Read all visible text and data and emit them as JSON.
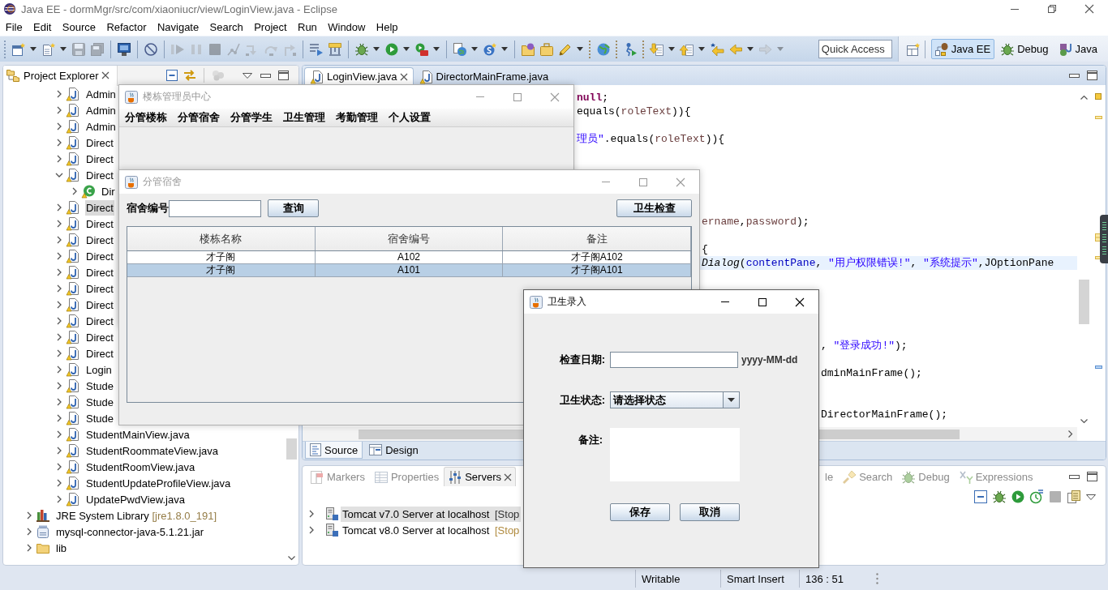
{
  "window": {
    "title": "Java EE - dormMgr/src/com/xiaoniucr/view/LoginView.java - Eclipse"
  },
  "menu": [
    "File",
    "Edit",
    "Source",
    "Refactor",
    "Navigate",
    "Search",
    "Project",
    "Run",
    "Window",
    "Help"
  ],
  "toolbar": [
    {
      "disabled": false
    },
    {
      "disabled": false
    },
    {
      "disabled": true
    },
    {
      "disabled": true
    },
    {
      "disabled": false
    },
    {
      "disabled": false
    },
    {
      "disabled": true
    },
    {
      "disabled": true
    },
    {
      "disabled": true
    },
    {
      "disabled": true
    },
    {
      "disabled": true
    },
    {
      "disabled": true
    },
    {
      "disabled": true
    },
    {
      "disabled": false
    },
    {
      "disabled": false
    },
    {
      "disabled": false
    },
    {
      "disabled": false
    },
    {
      "disabled": false
    },
    {
      "disabled": false
    },
    {
      "disabled": false
    },
    {
      "disabled": false
    },
    {
      "disabled": false
    },
    {
      "disabled": false
    },
    {
      "disabled": false
    },
    {
      "disabled": false
    },
    {
      "disabled": false
    },
    {
      "disabled": false
    },
    {
      "disabled": false
    },
    {
      "disabled": false
    },
    {
      "disabled": true
    }
  ],
  "quick_access": {
    "placeholder": "Quick Access"
  },
  "perspectives": [
    {
      "label": "Java EE",
      "selected": true
    },
    {
      "label": "Debug",
      "selected": false
    },
    {
      "label": "Java",
      "selected": false
    }
  ],
  "project_explorer": {
    "title": "Project Explorer",
    "package_files": [
      {
        "label": "Admin",
        "kind": "java_file",
        "expanded": false,
        "selected": false
      },
      {
        "label": "Admin",
        "kind": "java_file",
        "expanded": false,
        "selected": false
      },
      {
        "label": "Admin",
        "kind": "java_file",
        "expanded": false,
        "selected": false
      },
      {
        "label": "Direct",
        "kind": "java_file",
        "expanded": false,
        "selected": false
      },
      {
        "label": "Direct",
        "kind": "java_file",
        "expanded": false,
        "selected": false
      },
      {
        "label": "Direct",
        "kind": "java_file",
        "expanded": true,
        "selected": false,
        "children": [
          {
            "label": "Dir",
            "kind": "class",
            "expanded": false,
            "selected": false
          }
        ]
      },
      {
        "label": "Direct",
        "kind": "java_file",
        "expanded": false,
        "selected": true
      },
      {
        "label": "Direct",
        "kind": "java_file",
        "expanded": false,
        "selected": false
      },
      {
        "label": "Direct",
        "kind": "java_file",
        "expanded": false,
        "selected": false
      },
      {
        "label": "Direct",
        "kind": "java_file",
        "expanded": false,
        "selected": false
      },
      {
        "label": "Direct",
        "kind": "java_file",
        "expanded": false,
        "selected": false
      },
      {
        "label": "Direct",
        "kind": "java_file",
        "expanded": false,
        "selected": false
      },
      {
        "label": "Direct",
        "kind": "java_file",
        "expanded": false,
        "selected": false
      },
      {
        "label": "Direct",
        "kind": "java_file",
        "expanded": false,
        "selected": false
      },
      {
        "label": "Direct",
        "kind": "java_file",
        "expanded": false,
        "selected": false
      },
      {
        "label": "Direct",
        "kind": "java_file",
        "expanded": false,
        "selected": false
      },
      {
        "label": "Login",
        "kind": "java_file",
        "expanded": false,
        "selected": false
      },
      {
        "label": "Stude",
        "kind": "java_file",
        "expanded": false,
        "selected": false
      },
      {
        "label": "Stude",
        "kind": "java_file",
        "expanded": false,
        "selected": false
      },
      {
        "label": "Stude",
        "kind": "java_file",
        "expanded": false,
        "selected": false
      },
      {
        "label": "StudentMainView.java",
        "kind": "java_file",
        "expanded": false,
        "selected": false
      },
      {
        "label": "StudentRoommateView.java",
        "kind": "java_file",
        "expanded": false,
        "selected": false
      },
      {
        "label": "StudentRoomView.java",
        "kind": "java_file",
        "expanded": false,
        "selected": false
      },
      {
        "label": "StudentUpdateProfileView.java",
        "kind": "java_file",
        "expanded": false,
        "selected": false
      },
      {
        "label": "UpdatePwdView.java",
        "kind": "java_file",
        "expanded": false,
        "selected": false
      }
    ],
    "project_items": [
      {
        "label": "JRE System Library",
        "decoration": "[jre1.8.0_191]",
        "kind": "library",
        "expanded": false,
        "selected": false
      },
      {
        "label": "mysql-connector-java-5.1.21.jar",
        "kind": "jar",
        "expanded": false,
        "selected": false
      },
      {
        "label": "lib",
        "kind": "folder",
        "expanded": false,
        "selected": false
      }
    ]
  },
  "editor": {
    "tabs": [
      {
        "label": "LoginView.java",
        "selected": true
      },
      {
        "label": "DirectorMainFrame.java",
        "selected": false
      }
    ],
    "lines": [
      {
        "current": false,
        "tokens": [
          {
            "kind": "keyword",
            "text": "null"
          },
          {
            "kind": "plain",
            "text": ";"
          }
        ]
      },
      {
        "current": false,
        "tokens": [
          {
            "kind": "plain",
            "text": "equals("
          },
          {
            "kind": "local",
            "text": "roleText"
          },
          {
            "kind": "plain",
            "text": ")){"
          }
        ]
      },
      {
        "current": false,
        "tokens": [
          {
            "kind": "string",
            "text": "理员\""
          },
          {
            "kind": "plain",
            "text": ".equals("
          },
          {
            "kind": "local",
            "text": "roleText"
          },
          {
            "kind": "plain",
            "text": ")){"
          }
        ]
      },
      {
        "current": false,
        "tokens": [
          {
            "kind": "local",
            "text": "ername"
          },
          {
            "kind": "plain",
            "text": ","
          },
          {
            "kind": "local",
            "text": "password"
          },
          {
            "kind": "plain",
            "text": ");"
          }
        ]
      },
      {
        "current": false,
        "tokens": [
          {
            "kind": "plain",
            "text": "{"
          }
        ]
      },
      {
        "current": true,
        "tokens": [
          {
            "kind": "static",
            "text": "Dialog"
          },
          {
            "kind": "plain",
            "text": "("
          },
          {
            "kind": "field",
            "text": "contentPane"
          },
          {
            "kind": "plain",
            "text": ", "
          },
          {
            "kind": "string",
            "text": "\"用户权限错误!\""
          },
          {
            "kind": "plain",
            "text": ", "
          },
          {
            "kind": "string",
            "text": "\"系统提示\""
          },
          {
            "kind": "plain",
            "text": ",JOptionPane"
          }
        ]
      },
      {
        "current": false,
        "tokens": [
          {
            "kind": "plain",
            "text": ", "
          },
          {
            "kind": "string",
            "text": "\"登录成功!\""
          },
          {
            "kind": "plain",
            "text": ");"
          }
        ]
      },
      {
        "current": false,
        "tokens": [
          {
            "kind": "plain",
            "text": "dminMainFrame();"
          }
        ]
      },
      {
        "current": false,
        "tokens": [
          {
            "kind": "plain",
            "text": "DirectorMainFrame();"
          }
        ]
      }
    ],
    "view_tabs": [
      {
        "label": "Source",
        "selected": true
      },
      {
        "label": "Design",
        "selected": false
      }
    ]
  },
  "bottom_panel": {
    "tabs": [
      {
        "label": "Markers",
        "selected": false
      },
      {
        "label": "Properties",
        "selected": false
      },
      {
        "label": "Servers",
        "selected": true
      },
      {
        "label": "le",
        "selected": false
      },
      {
        "label": "Search",
        "selected": false
      },
      {
        "label": "Debug",
        "selected": false
      },
      {
        "label": "Expressions",
        "selected": false
      }
    ],
    "toolbar": [
      {
        "disabled": false
      },
      {
        "disabled": false
      },
      {
        "disabled": false
      },
      {
        "disabled": false
      },
      {
        "disabled": true
      },
      {
        "disabled": false
      }
    ],
    "servers": [
      {
        "name": "Tomcat v7.0 Server at localhost",
        "status": "[Stop",
        "expanded": false,
        "selected": true
      },
      {
        "name": "Tomcat v8.0 Server at localhost",
        "status": "[Stop",
        "expanded": false,
        "selected": false
      }
    ]
  },
  "status_bar": [
    "Writable",
    "Smart Insert",
    "136 : 51"
  ],
  "building_admin_window": {
    "title": "楼栋管理员中心",
    "active": false,
    "menu": [
      "分管楼栋",
      "分管宿舍",
      "分管学生",
      "卫生管理",
      "考勤管理",
      "个人设置"
    ]
  },
  "dorm_window": {
    "title": "分管宿舍",
    "active": false,
    "search_label": "宿舍编号",
    "query_button": "查询",
    "check_button": "卫生检查",
    "table": {
      "columns": [
        "楼栋名称",
        "宿舍编号",
        "备注"
      ],
      "rows": [
        {
          "cells": [
            "才子阁",
            "A102",
            "才子阁A102"
          ],
          "selected": false
        },
        {
          "cells": [
            "才子阁",
            "A101",
            "才子阁A101"
          ],
          "selected": true
        }
      ]
    }
  },
  "hygiene_dialog": {
    "title": "卫生录入",
    "active": true,
    "fields": [
      {
        "kind": "date",
        "label": "检查日期:",
        "format_label": "yyyy-MM-dd"
      },
      {
        "kind": "select",
        "label": "卫生状态:",
        "value": "请选择状态"
      },
      {
        "kind": "textarea",
        "label": "备注:"
      }
    ],
    "buttons": [
      "保存",
      "取消"
    ]
  }
}
